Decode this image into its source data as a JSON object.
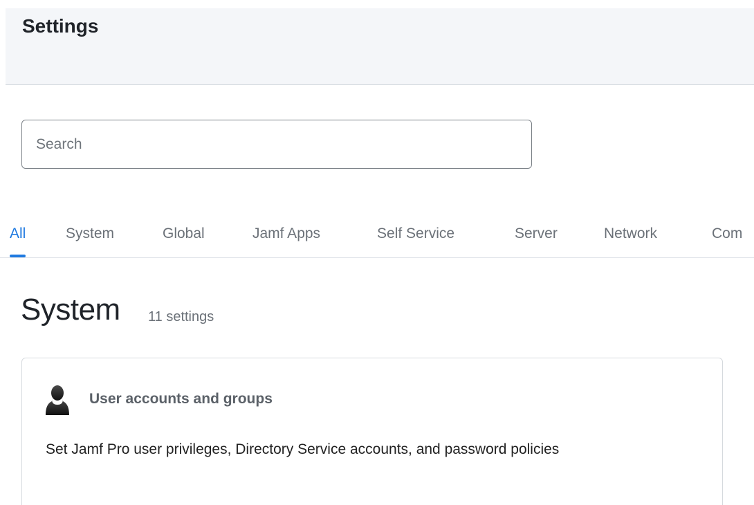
{
  "header": {
    "title": "Settings"
  },
  "search": {
    "placeholder": "Search",
    "value": ""
  },
  "tabs": [
    {
      "label": "All",
      "active": true
    },
    {
      "label": "System",
      "active": false
    },
    {
      "label": "Global",
      "active": false
    },
    {
      "label": "Jamf Apps",
      "active": false
    },
    {
      "label": "Self Service",
      "active": false
    },
    {
      "label": "Server",
      "active": false
    },
    {
      "label": "Network",
      "active": false
    },
    {
      "label": "Com",
      "active": false
    }
  ],
  "section": {
    "title": "System",
    "count": "11 settings"
  },
  "cards": [
    {
      "icon": "user-icon",
      "title": "User accounts and groups",
      "description": "Set Jamf Pro user privileges, Directory Service accounts, and password policies"
    }
  ],
  "colors": {
    "accent": "#1f7ae0",
    "header_bg": "#f4f6f9"
  }
}
